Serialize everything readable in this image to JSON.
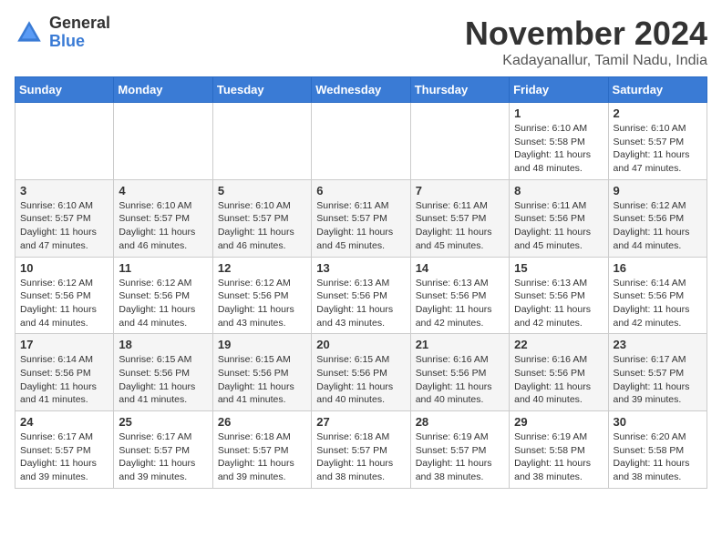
{
  "logo": {
    "general": "General",
    "blue": "Blue"
  },
  "title": "November 2024",
  "subtitle": "Kadayanallur, Tamil Nadu, India",
  "days_of_week": [
    "Sunday",
    "Monday",
    "Tuesday",
    "Wednesday",
    "Thursday",
    "Friday",
    "Saturday"
  ],
  "weeks": [
    [
      {
        "day": "",
        "info": ""
      },
      {
        "day": "",
        "info": ""
      },
      {
        "day": "",
        "info": ""
      },
      {
        "day": "",
        "info": ""
      },
      {
        "day": "",
        "info": ""
      },
      {
        "day": "1",
        "info": "Sunrise: 6:10 AM\nSunset: 5:58 PM\nDaylight: 11 hours and 48 minutes."
      },
      {
        "day": "2",
        "info": "Sunrise: 6:10 AM\nSunset: 5:57 PM\nDaylight: 11 hours and 47 minutes."
      }
    ],
    [
      {
        "day": "3",
        "info": "Sunrise: 6:10 AM\nSunset: 5:57 PM\nDaylight: 11 hours and 47 minutes."
      },
      {
        "day": "4",
        "info": "Sunrise: 6:10 AM\nSunset: 5:57 PM\nDaylight: 11 hours and 46 minutes."
      },
      {
        "day": "5",
        "info": "Sunrise: 6:10 AM\nSunset: 5:57 PM\nDaylight: 11 hours and 46 minutes."
      },
      {
        "day": "6",
        "info": "Sunrise: 6:11 AM\nSunset: 5:57 PM\nDaylight: 11 hours and 45 minutes."
      },
      {
        "day": "7",
        "info": "Sunrise: 6:11 AM\nSunset: 5:57 PM\nDaylight: 11 hours and 45 minutes."
      },
      {
        "day": "8",
        "info": "Sunrise: 6:11 AM\nSunset: 5:56 PM\nDaylight: 11 hours and 45 minutes."
      },
      {
        "day": "9",
        "info": "Sunrise: 6:12 AM\nSunset: 5:56 PM\nDaylight: 11 hours and 44 minutes."
      }
    ],
    [
      {
        "day": "10",
        "info": "Sunrise: 6:12 AM\nSunset: 5:56 PM\nDaylight: 11 hours and 44 minutes."
      },
      {
        "day": "11",
        "info": "Sunrise: 6:12 AM\nSunset: 5:56 PM\nDaylight: 11 hours and 44 minutes."
      },
      {
        "day": "12",
        "info": "Sunrise: 6:12 AM\nSunset: 5:56 PM\nDaylight: 11 hours and 43 minutes."
      },
      {
        "day": "13",
        "info": "Sunrise: 6:13 AM\nSunset: 5:56 PM\nDaylight: 11 hours and 43 minutes."
      },
      {
        "day": "14",
        "info": "Sunrise: 6:13 AM\nSunset: 5:56 PM\nDaylight: 11 hours and 42 minutes."
      },
      {
        "day": "15",
        "info": "Sunrise: 6:13 AM\nSunset: 5:56 PM\nDaylight: 11 hours and 42 minutes."
      },
      {
        "day": "16",
        "info": "Sunrise: 6:14 AM\nSunset: 5:56 PM\nDaylight: 11 hours and 42 minutes."
      }
    ],
    [
      {
        "day": "17",
        "info": "Sunrise: 6:14 AM\nSunset: 5:56 PM\nDaylight: 11 hours and 41 minutes."
      },
      {
        "day": "18",
        "info": "Sunrise: 6:15 AM\nSunset: 5:56 PM\nDaylight: 11 hours and 41 minutes."
      },
      {
        "day": "19",
        "info": "Sunrise: 6:15 AM\nSunset: 5:56 PM\nDaylight: 11 hours and 41 minutes."
      },
      {
        "day": "20",
        "info": "Sunrise: 6:15 AM\nSunset: 5:56 PM\nDaylight: 11 hours and 40 minutes."
      },
      {
        "day": "21",
        "info": "Sunrise: 6:16 AM\nSunset: 5:56 PM\nDaylight: 11 hours and 40 minutes."
      },
      {
        "day": "22",
        "info": "Sunrise: 6:16 AM\nSunset: 5:56 PM\nDaylight: 11 hours and 40 minutes."
      },
      {
        "day": "23",
        "info": "Sunrise: 6:17 AM\nSunset: 5:57 PM\nDaylight: 11 hours and 39 minutes."
      }
    ],
    [
      {
        "day": "24",
        "info": "Sunrise: 6:17 AM\nSunset: 5:57 PM\nDaylight: 11 hours and 39 minutes."
      },
      {
        "day": "25",
        "info": "Sunrise: 6:17 AM\nSunset: 5:57 PM\nDaylight: 11 hours and 39 minutes."
      },
      {
        "day": "26",
        "info": "Sunrise: 6:18 AM\nSunset: 5:57 PM\nDaylight: 11 hours and 39 minutes."
      },
      {
        "day": "27",
        "info": "Sunrise: 6:18 AM\nSunset: 5:57 PM\nDaylight: 11 hours and 38 minutes."
      },
      {
        "day": "28",
        "info": "Sunrise: 6:19 AM\nSunset: 5:57 PM\nDaylight: 11 hours and 38 minutes."
      },
      {
        "day": "29",
        "info": "Sunrise: 6:19 AM\nSunset: 5:58 PM\nDaylight: 11 hours and 38 minutes."
      },
      {
        "day": "30",
        "info": "Sunrise: 6:20 AM\nSunset: 5:58 PM\nDaylight: 11 hours and 38 minutes."
      }
    ]
  ]
}
